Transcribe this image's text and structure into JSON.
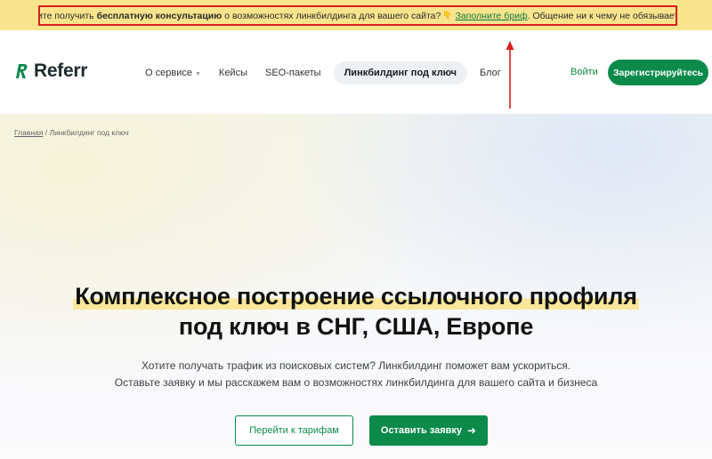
{
  "announcement": {
    "prefix": "Хотите получить",
    "bold": "бесплатную консультацию",
    "middle": "о возможностях линкбилдинга для вашего сайта?",
    "link": "Заполните бриф",
    "suffix": ". Общение ни к чему не обязывает"
  },
  "header": {
    "logo": "Referr",
    "nav": [
      {
        "label": "О сервисе",
        "has_dropdown": true
      },
      {
        "label": "Кейсы"
      },
      {
        "label": "SEO-пакеты"
      },
      {
        "label": "Линкбилдинг под ключ",
        "active": true
      },
      {
        "label": "Блог"
      }
    ],
    "login": "Войти",
    "register": "Зарегистрируйтесь"
  },
  "breadcrumb": {
    "home": "Главная",
    "separator": "/",
    "current": "Линкбилдинг под ключ"
  },
  "hero": {
    "title_line1": "Комплексное построение ссылочного профиля",
    "title_line2": "под ключ в СНГ, США, Европе",
    "subtitle_line1": "Хотите получать трафик из поисковых систем? Линкбилдинг поможет вам ускориться.",
    "subtitle_line2": "Оставьте заявку и мы расскажем вам о возможностях линкбилдинга для вашего сайта и бизнеса",
    "btn_tariffs": "Перейти к тарифам",
    "btn_request": "Оставить заявку"
  },
  "colors": {
    "brand_green": "#0b8a4a",
    "announce_bg": "#f8e48d",
    "highlight_border": "#d91e1e"
  },
  "icons": [
    "logo-r-icon",
    "chevron-down-icon",
    "arrow-right-icon",
    "pointer-arrow-icon"
  ]
}
